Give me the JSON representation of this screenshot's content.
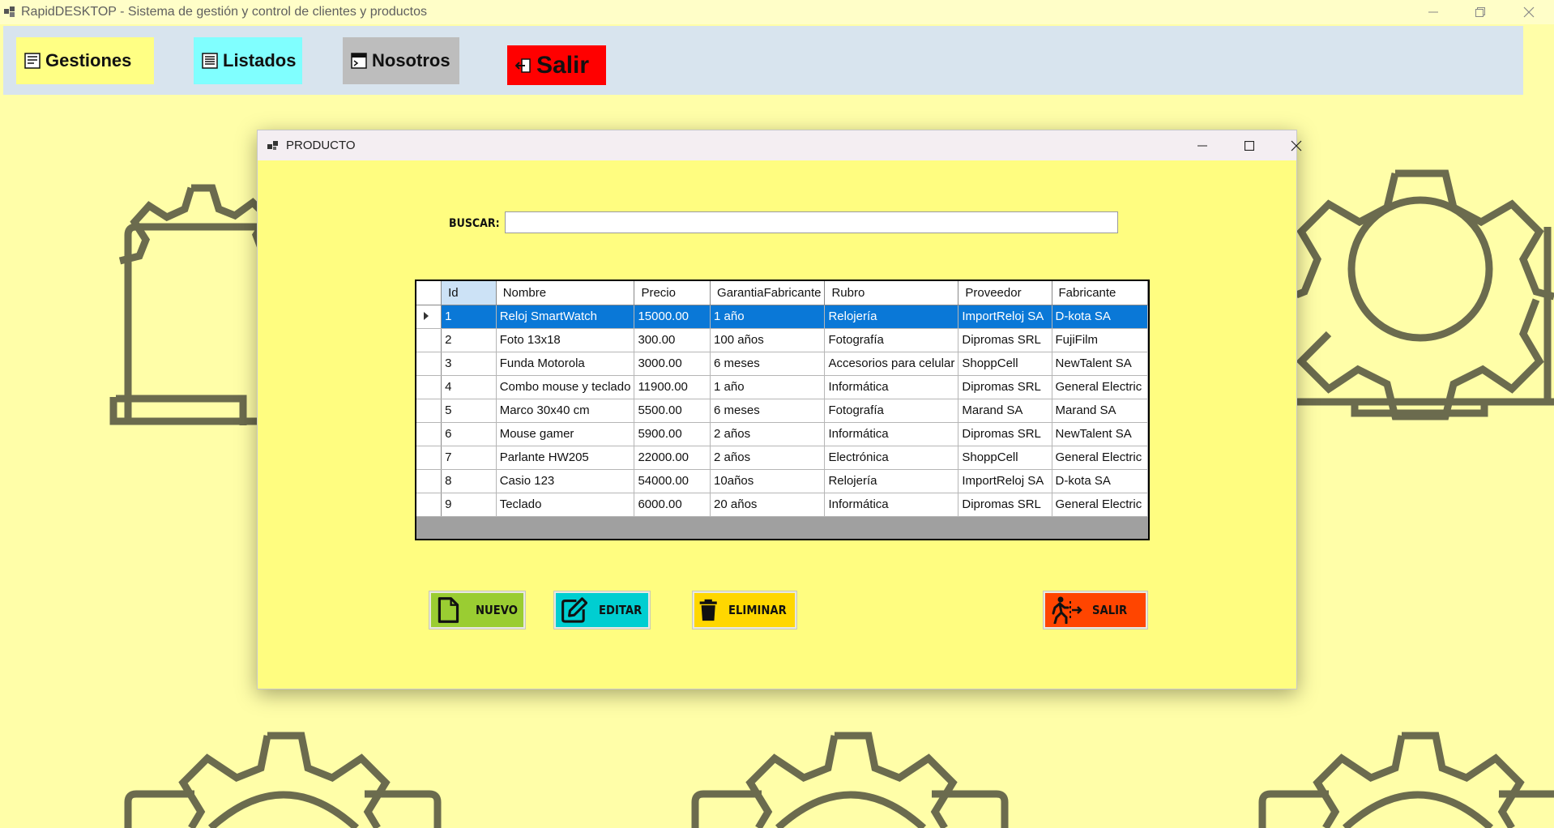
{
  "window": {
    "title": "RapidDESKTOP - Sistema de gestión y control de clientes y productos"
  },
  "menu": {
    "items": [
      {
        "label": "Gestiones",
        "icon": "gestiones-icon",
        "color": "#ffff84"
      },
      {
        "label": "Listados",
        "icon": "listados-icon",
        "color": "#80ffff"
      },
      {
        "label": "Nosotros",
        "icon": "nosotros-icon",
        "color": "#bdbdbd"
      },
      {
        "label": "Salir",
        "icon": "salir-icon",
        "color": "#ff0000"
      }
    ]
  },
  "dialog": {
    "title": "PRODUCTO",
    "search_label": "BUSCAR:",
    "search_value": "",
    "grid": {
      "columns": [
        "Id",
        "Nombre",
        "Precio",
        "GarantiaFabricante",
        "Rubro",
        "Proveedor",
        "Fabricante"
      ],
      "rows": [
        [
          "1",
          "Reloj SmartWatch",
          "15000.00",
          "1 año",
          "Relojería",
          "ImportReloj SA",
          "D-kota SA"
        ],
        [
          "2",
          "Foto 13x18",
          "300.00",
          "100 años",
          "Fotografía",
          "Dipromas SRL",
          "FujiFilm"
        ],
        [
          "3",
          "Funda Motorola",
          "3000.00",
          "6 meses",
          "Accesorios para celular",
          "ShoppCell",
          "NewTalent SA"
        ],
        [
          "4",
          "Combo mouse y teclado",
          "11900.00",
          "1 año",
          "Informática",
          "Dipromas SRL",
          "General Electric"
        ],
        [
          "5",
          "Marco 30x40 cm",
          "5500.00",
          "6 meses",
          "Fotografía",
          "Marand SA",
          "Marand SA"
        ],
        [
          "6",
          "Mouse gamer",
          "5900.00",
          "2 años",
          "Informática",
          "Dipromas SRL",
          "NewTalent SA"
        ],
        [
          "7",
          "Parlante HW205",
          "22000.00",
          "2 años",
          "Electrónica",
          "ShoppCell",
          "General Electric"
        ],
        [
          "8",
          "Casio 123",
          "54000.00",
          "10años",
          "Relojería",
          "ImportReloj SA",
          "D-kota SA"
        ],
        [
          "9",
          "Teclado",
          "6000.00",
          "20 años",
          "Informática",
          "Dipromas SRL",
          "General Electric"
        ]
      ],
      "selected_row": 0
    },
    "buttons": {
      "nuevo": {
        "label": "NUEVO",
        "color": "#9acd32"
      },
      "editar": {
        "label": "EDITAR",
        "color": "#00ced1"
      },
      "eliminar": {
        "label": "ELIMINAR",
        "color": "#ffd700"
      },
      "salir": {
        "label": "SALIR",
        "color": "#ff4500"
      }
    }
  }
}
